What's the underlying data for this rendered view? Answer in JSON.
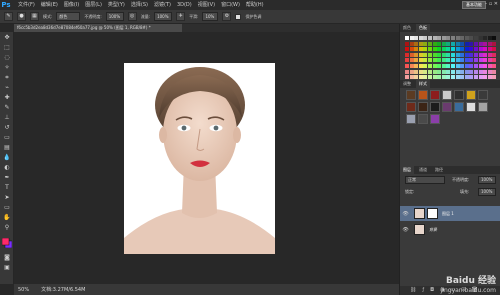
{
  "app": {
    "logo": "Ps"
  },
  "menus": [
    "文件(F)",
    "编辑(E)",
    "图像(I)",
    "图层(L)",
    "类型(Y)",
    "选择(S)",
    "滤镜(T)",
    "3D(D)",
    "视图(V)",
    "窗口(W)",
    "帮助(H)"
  ],
  "workspace": "基本功能",
  "window_buttons": "– ▫ ✕",
  "options": {
    "mode_label": "模式:",
    "mode_value": "颜色",
    "opacity_label": "不透明度:",
    "opacity_value": "100%",
    "flow_label": "流量:",
    "flow_value": "100%",
    "smooth_label": "平滑:",
    "smooth_value": "10%",
    "checkbox_label": "保护色调"
  },
  "document": {
    "tab_title": "f6cc5b3d2ea8d36d7e87084ef60a77.jpg @ 50% (图层 1, RGB/8#) *"
  },
  "status": {
    "zoom": "50%",
    "doc_info": "文档:3.27M/6.54M"
  },
  "panels": {
    "color_tabs": [
      "颜色",
      "色板"
    ],
    "adjust_tabs": [
      "调整",
      "样式"
    ],
    "layers_tabs": [
      "图层",
      "通道",
      "路径"
    ],
    "blend_mode": "正常",
    "opacity_label": "不透明度:",
    "opacity_value": "100%",
    "lock_label": "锁定:",
    "fill_label": "填充:",
    "fill_value": "100%",
    "layers": [
      {
        "name": "图层 1"
      },
      {
        "name": "背景"
      }
    ]
  },
  "colors": {
    "panel_bg": "#3a3a3a",
    "canvas_bg": "#282828",
    "selected_layer": "#5a6f8c",
    "accent": "#30a8ff"
  },
  "watermark": {
    "text": "Baidu 经验",
    "url": "jingyan.baidu.com"
  }
}
